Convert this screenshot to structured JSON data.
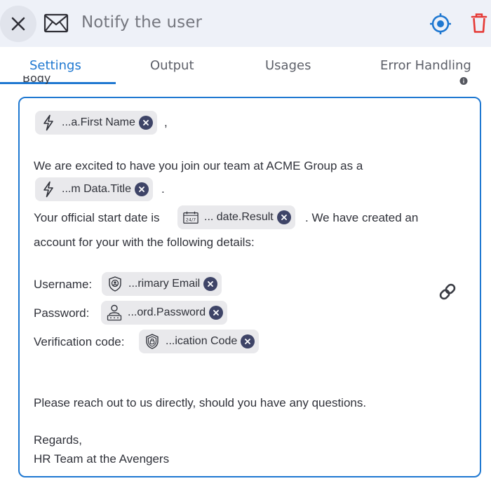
{
  "header": {
    "title": "Notify the user",
    "close_icon": "close-icon",
    "mail_icon": "envelope-icon",
    "target_icon": "target-icon",
    "delete_icon": "trash-icon"
  },
  "tabs": [
    {
      "label": "Settings",
      "active": true
    },
    {
      "label": "Output",
      "active": false
    },
    {
      "label": "Usages",
      "active": false
    },
    {
      "label": "Error Handling",
      "active": false
    }
  ],
  "body_field": {
    "label": "Body"
  },
  "editor": {
    "greeting_suffix": ",",
    "line_intro": "We are excited to have you join our team at ACME Group as a",
    "title_suffix": ".",
    "start_date_prefix": "Your official start date is",
    "start_date_suffix": ". We have created an",
    "account_line": "account for your with the following details:",
    "username_label": "Username:",
    "password_label": "Password:",
    "verification_label": "Verification code:",
    "reach_out": "Please reach out to us directly, should you have any questions.",
    "regards": "Regards,",
    "signature": "HR Team at the Avengers",
    "chips": {
      "first_name": "...a.First Name",
      "title": "...m Data.Title",
      "date": "... date.Result",
      "email": "...rimary Email",
      "password": "...ord.Password",
      "verification": "...ication Code"
    }
  },
  "colors": {
    "accent": "#1f78d1",
    "delete": "#e53935",
    "chip_bg": "#e9e9ec",
    "chip_close": "#3e4467"
  }
}
